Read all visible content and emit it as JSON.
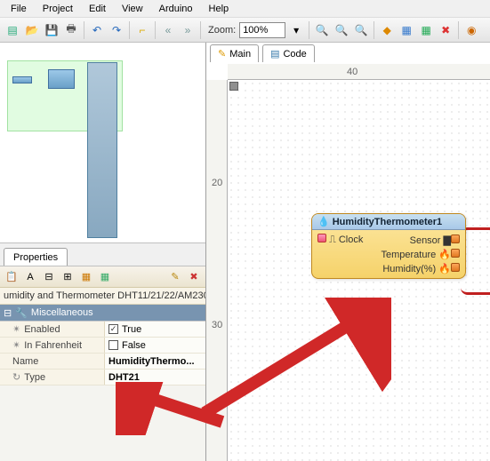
{
  "menu": {
    "file": "File",
    "project": "Project",
    "edit": "Edit",
    "view": "View",
    "arduino": "Arduino",
    "help": "Help"
  },
  "toolbar": {
    "zoom_label": "Zoom:",
    "zoom_value": "100%"
  },
  "tabs": {
    "main": "Main",
    "code": "Code"
  },
  "ruler": {
    "h40": "40",
    "v20": "20",
    "v30": "30"
  },
  "node": {
    "title": "HumidityThermometer1",
    "clock": "Clock",
    "sensor": "Sensor",
    "temperature": "Temperature",
    "humidity": "Humidity(%)"
  },
  "properties": {
    "tab": "Properties",
    "title": "umidity and Thermometer DHT11/21/22/AM230",
    "category": "Miscellaneous",
    "rows": {
      "enabled": {
        "name": "Enabled",
        "value": "True",
        "checked": true
      },
      "infahrenheit": {
        "name": "In Fahrenheit",
        "value": "False",
        "checked": false
      },
      "name": {
        "name": "Name",
        "value": "HumidityThermo..."
      },
      "type": {
        "name": "Type",
        "value": "DHT21"
      }
    }
  }
}
